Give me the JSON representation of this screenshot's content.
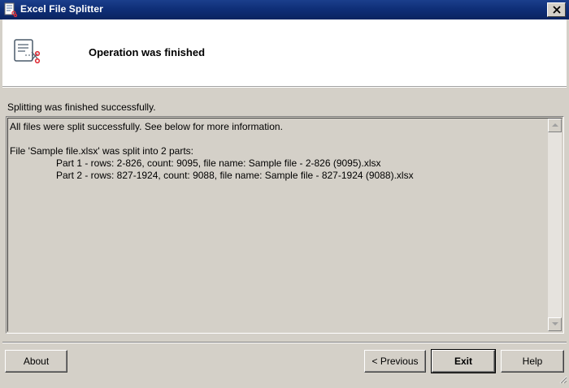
{
  "window": {
    "title": "Excel File Splitter"
  },
  "header": {
    "title": "Operation was finished",
    "icon": "document-scissors-icon"
  },
  "status": {
    "text": "Splitting was finished successfully."
  },
  "log": {
    "lines": [
      {
        "text": "All files were split successfully. See below for more information.",
        "indent": false
      },
      {
        "text": "",
        "indent": false
      },
      {
        "text": "File 'Sample file.xlsx' was split into 2 parts:",
        "indent": false
      },
      {
        "text": "Part 1 - rows: 2-826, count: 9095, file name: Sample file - 2-826 (9095).xlsx",
        "indent": true
      },
      {
        "text": "Part 2 - rows: 827-1924, count: 9088, file name: Sample file - 827-1924 (9088).xlsx",
        "indent": true
      }
    ]
  },
  "buttons": {
    "about": "About",
    "previous": "< Previous",
    "exit": "Exit",
    "help": "Help"
  },
  "colors": {
    "titlebar": "#0f2f78",
    "face": "#d4d0c8",
    "header_bg": "#ffffff",
    "icon_accent": "#e0303a"
  }
}
